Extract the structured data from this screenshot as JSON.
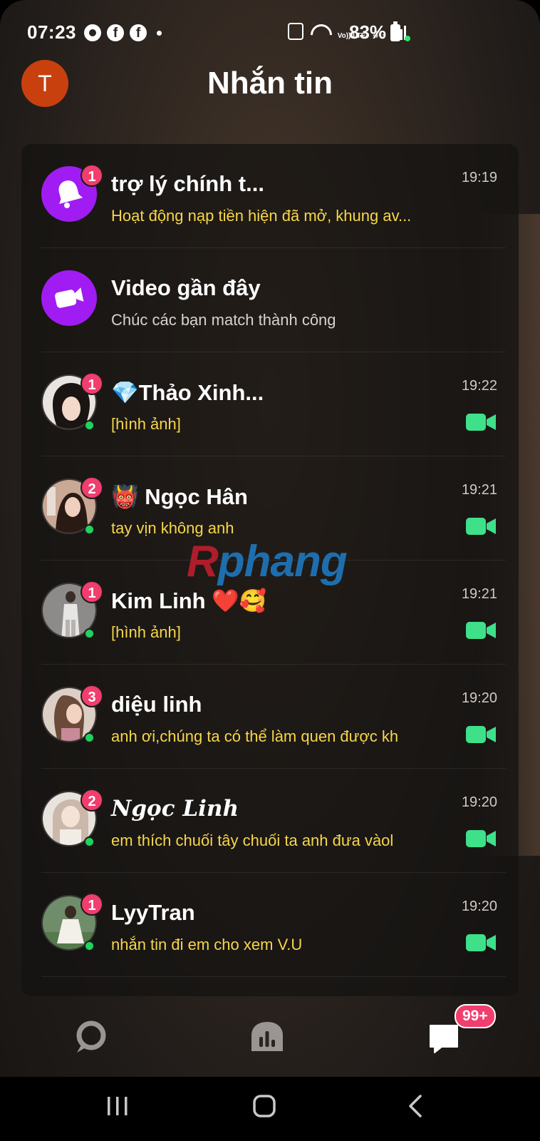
{
  "status_bar": {
    "time": "07:23",
    "notif_fb": "f",
    "lte": "Vo)) LTE",
    "network": "4G",
    "battery": "83%"
  },
  "header": {
    "avatar_letter": "T",
    "title": "Nhắn tin"
  },
  "chats": [
    {
      "name": "trợ lý chính t...",
      "preview": "Hoạt động nạp tiền hiện đã mở, khung av...",
      "time": "19:19",
      "unread": "1",
      "avatar": "bell-icon",
      "online": false,
      "video": false
    },
    {
      "name": "Video gần đây",
      "preview": "Chúc các bạn match thành công",
      "time": "",
      "unread": "",
      "avatar": "video-camera-icon",
      "online": false,
      "video": false
    },
    {
      "name": "💎Thảo Xinh...",
      "preview": "[hình ảnh]",
      "time": "19:22",
      "unread": "1",
      "avatar": "photo",
      "online": true,
      "video": true
    },
    {
      "name": "👹 Ngọc Hân",
      "preview": "tay vịn không anh",
      "time": "19:21",
      "unread": "2",
      "avatar": "photo",
      "online": true,
      "video": true
    },
    {
      "name": "Kim Linh ❤️🥰",
      "preview": "[hình ảnh]",
      "time": "19:21",
      "unread": "1",
      "avatar": "photo",
      "online": true,
      "video": true
    },
    {
      "name": "diệu linh",
      "preview": "anh ơi,chúng ta có thể làm quen được kh",
      "time": "19:20",
      "unread": "3",
      "avatar": "photo",
      "online": true,
      "video": true
    },
    {
      "name": "Ngọc Linh",
      "preview": "em thích chuối tây chuối ta anh đưa vàol",
      "time": "19:20",
      "unread": "2",
      "avatar": "photo",
      "online": true,
      "video": true
    },
    {
      "name": "LyyTran",
      "preview": "nhắn tin đi em cho xem V.U",
      "time": "19:20",
      "unread": "1",
      "avatar": "photo",
      "online": true,
      "video": true
    }
  ],
  "watermark": {
    "part1": "R",
    "part2": "phang"
  },
  "bottom_nav": {
    "messages_badge": "99+"
  },
  "colors": {
    "accent_purple": "#a11cf2",
    "badge_pink": "#f03e6e",
    "preview_yellow": "#f6d64a",
    "video_green": "#3ee08a",
    "online_green": "#1ed35e"
  }
}
